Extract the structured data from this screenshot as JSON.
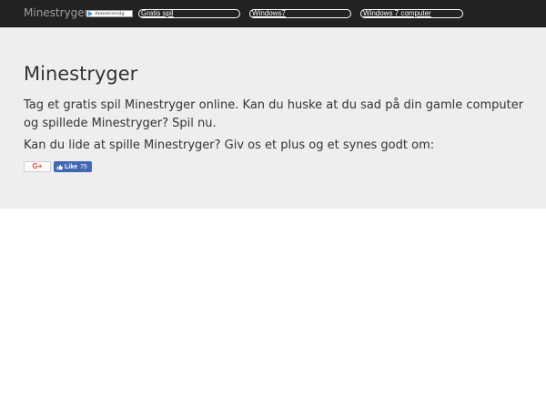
{
  "nav": {
    "brand": "Minestryger",
    "ad_label": "Annoncevalg",
    "links": [
      "Gratis spil",
      "Windows7",
      "Windows 7 computer"
    ]
  },
  "main": {
    "title": "Minestryger",
    "intro": "Tag et gratis spil Minestryger online. Kan du huske at du sad på din gamle computer og spillede Minestryger? Spil nu.",
    "question": "Kan du lide at spille Minestryger? Giv os et plus og et synes godt om:"
  },
  "social": {
    "gplus_label": "G+",
    "like_label": "Like",
    "like_count": "75"
  },
  "colors": {
    "navbar": "#222222",
    "jumbotron": "#eeeeee",
    "facebook": "#4267b2"
  },
  "icons": [
    "adchoices-icon",
    "thumbs-up-icon"
  ]
}
